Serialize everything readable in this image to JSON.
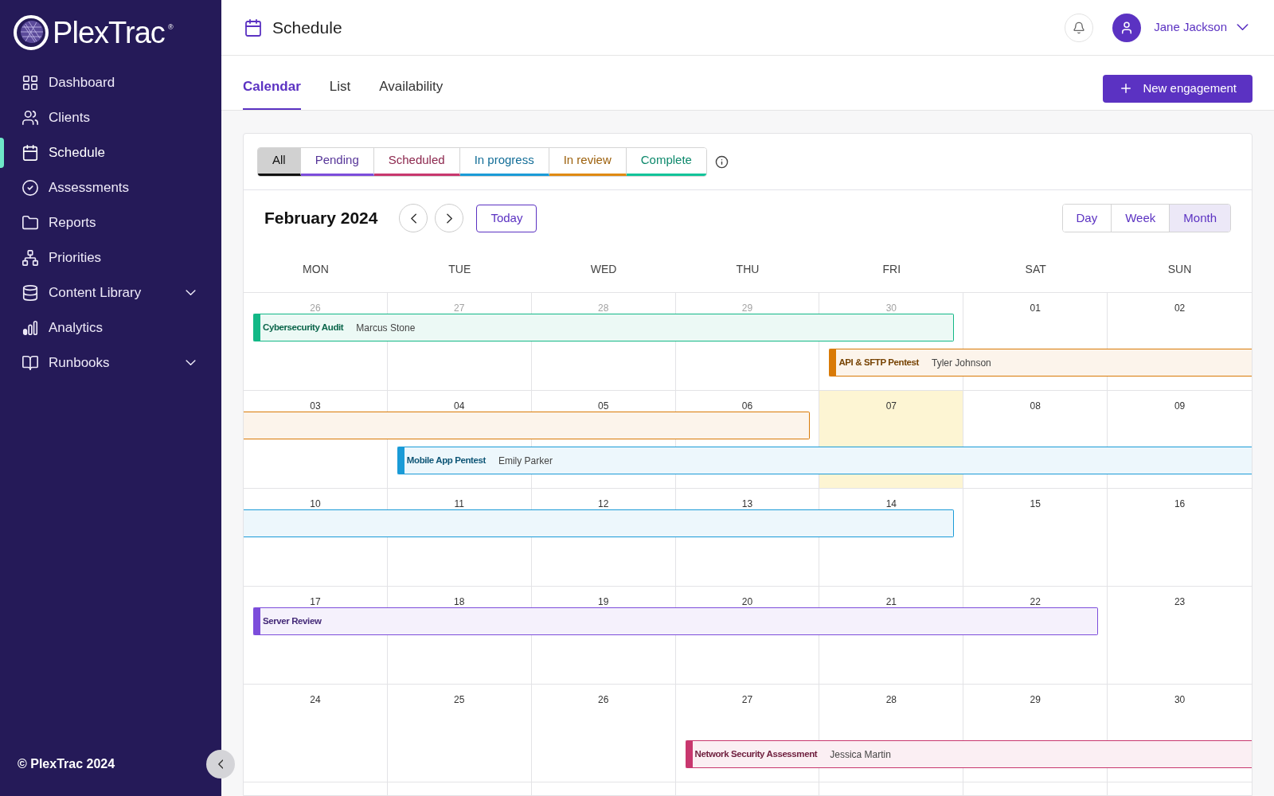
{
  "brand": {
    "name": "PlexTrac",
    "mark": "®"
  },
  "sidebar": {
    "items": [
      {
        "label": "Dashboard",
        "selected": false,
        "has_submenu": false
      },
      {
        "label": "Clients",
        "selected": false,
        "has_submenu": false
      },
      {
        "label": "Schedule",
        "selected": true,
        "has_submenu": false
      },
      {
        "label": "Assessments",
        "selected": false,
        "has_submenu": false
      },
      {
        "label": "Reports",
        "selected": false,
        "has_submenu": false
      },
      {
        "label": "Priorities",
        "selected": false,
        "has_submenu": false
      },
      {
        "label": "Content Library",
        "selected": false,
        "has_submenu": true
      },
      {
        "label": "Analytics",
        "selected": false,
        "has_submenu": false
      },
      {
        "label": "Runbooks",
        "selected": false,
        "has_submenu": true
      }
    ],
    "footer": "© PlexTrac 2024"
  },
  "header": {
    "title": "Schedule",
    "user": "Jane Jackson"
  },
  "tabs": [
    {
      "label": "Calendar",
      "selected": true
    },
    {
      "label": "List",
      "selected": false
    },
    {
      "label": "Availability",
      "selected": false
    }
  ],
  "new_button": "New engagement",
  "filters": [
    {
      "label": "All",
      "selected": true,
      "color": "#111111"
    },
    {
      "label": "Pending",
      "selected": false,
      "color": "#7c4ddb"
    },
    {
      "label": "Scheduled",
      "selected": false,
      "color": "#c8376e"
    },
    {
      "label": "In progress",
      "selected": false,
      "color": "#1a9bd7"
    },
    {
      "label": "In review",
      "selected": false,
      "color": "#e08a12"
    },
    {
      "label": "Complete",
      "selected": false,
      "color": "#12c49a"
    }
  ],
  "calendar": {
    "month": "February 2024",
    "today_button": "Today",
    "views": [
      {
        "label": "Day",
        "selected": false
      },
      {
        "label": "Week",
        "selected": false
      },
      {
        "label": "Month",
        "selected": true
      }
    ],
    "weekdays": [
      "MON",
      "TUE",
      "WED",
      "THU",
      "FRI",
      "SAT",
      "SUN"
    ],
    "weeks": [
      {
        "days": [
          {
            "label": "26",
            "muted": true,
            "today": false,
            "bars": [
              {
                "kind": "upper",
                "color": "#12b886",
                "starts": true,
                "ends": false,
                "title": "Cybersecurity Audit",
                "person": "Marcus Stone"
              }
            ]
          },
          {
            "label": "27",
            "muted": true,
            "today": false,
            "bars": [
              {
                "kind": "upper",
                "color": "#12b886",
                "starts": false,
                "ends": false
              }
            ]
          },
          {
            "label": "28",
            "muted": true,
            "today": false,
            "bars": [
              {
                "kind": "upper",
                "color": "#12b886",
                "starts": false,
                "ends": false
              }
            ]
          },
          {
            "label": "29",
            "muted": true,
            "today": false,
            "bars": [
              {
                "kind": "upper",
                "color": "#12b886",
                "starts": false,
                "ends": false
              }
            ]
          },
          {
            "label": "30",
            "muted": true,
            "today": false,
            "bars": [
              {
                "kind": "upper",
                "color": "#12b886",
                "starts": false,
                "ends": true
              },
              {
                "kind": "lower",
                "color": "#d97a06",
                "starts": true,
                "ends": false,
                "title": "API & SFTP Pentest",
                "person": "Tyler Johnson"
              }
            ]
          },
          {
            "label": "01",
            "muted": false,
            "today": false,
            "bars": [
              {
                "kind": "lower",
                "color": "#d97a06",
                "starts": false,
                "ends": false
              }
            ]
          },
          {
            "label": "02",
            "muted": false,
            "today": false,
            "bars": [
              {
                "kind": "lower",
                "color": "#d97a06",
                "starts": false,
                "ends": false
              }
            ]
          }
        ]
      },
      {
        "days": [
          {
            "label": "03",
            "muted": false,
            "today": false,
            "bars": [
              {
                "kind": "upper",
                "color": "#d97a06",
                "starts": false,
                "ends": false
              }
            ]
          },
          {
            "label": "04",
            "muted": false,
            "today": false,
            "bars": [
              {
                "kind": "upper",
                "color": "#d97a06",
                "starts": false,
                "ends": false
              },
              {
                "kind": "lower",
                "color": "#1a9bd7",
                "starts": true,
                "ends": false,
                "title": "Mobile App Pentest",
                "person": "Emily Parker"
              }
            ]
          },
          {
            "label": "05",
            "muted": false,
            "today": false,
            "bars": [
              {
                "kind": "upper",
                "color": "#d97a06",
                "starts": false,
                "ends": false
              },
              {
                "kind": "lower",
                "color": "#1a9bd7",
                "starts": false,
                "ends": false
              }
            ]
          },
          {
            "label": "06",
            "muted": false,
            "today": false,
            "bars": [
              {
                "kind": "upper",
                "color": "#d97a06",
                "starts": false,
                "ends": true
              },
              {
                "kind": "lower",
                "color": "#1a9bd7",
                "starts": false,
                "ends": false
              }
            ]
          },
          {
            "label": "07",
            "muted": false,
            "today": true,
            "bars": [
              {
                "kind": "lower",
                "color": "#1a9bd7",
                "starts": false,
                "ends": false
              }
            ]
          },
          {
            "label": "08",
            "muted": false,
            "today": false,
            "bars": [
              {
                "kind": "lower",
                "color": "#1a9bd7",
                "starts": false,
                "ends": false
              }
            ]
          },
          {
            "label": "09",
            "muted": false,
            "today": false,
            "bars": [
              {
                "kind": "lower",
                "color": "#1a9bd7",
                "starts": false,
                "ends": false
              }
            ]
          }
        ]
      },
      {
        "days": [
          {
            "label": "10",
            "muted": false,
            "today": false,
            "bars": [
              {
                "kind": "upper",
                "color": "#1a9bd7",
                "starts": false,
                "ends": false
              }
            ]
          },
          {
            "label": "11",
            "muted": false,
            "today": false,
            "bars": [
              {
                "kind": "upper",
                "color": "#1a9bd7",
                "starts": false,
                "ends": false
              }
            ]
          },
          {
            "label": "12",
            "muted": false,
            "today": false,
            "bars": [
              {
                "kind": "upper",
                "color": "#1a9bd7",
                "starts": false,
                "ends": false
              }
            ]
          },
          {
            "label": "13",
            "muted": false,
            "today": false,
            "bars": [
              {
                "kind": "upper",
                "color": "#1a9bd7",
                "starts": false,
                "ends": false
              }
            ]
          },
          {
            "label": "14",
            "muted": false,
            "today": false,
            "bars": [
              {
                "kind": "upper",
                "color": "#1a9bd7",
                "starts": false,
                "ends": true
              }
            ]
          },
          {
            "label": "15",
            "muted": false,
            "today": false
          },
          {
            "label": "16",
            "muted": false,
            "today": false
          }
        ]
      },
      {
        "days": [
          {
            "label": "17",
            "muted": false,
            "today": false,
            "bars": [
              {
                "kind": "upper",
                "color": "#7c4ddb",
                "starts": true,
                "ends": false,
                "title": "Server Review"
              }
            ]
          },
          {
            "label": "18",
            "muted": false,
            "today": false,
            "bars": [
              {
                "kind": "upper",
                "color": "#7c4ddb",
                "starts": false,
                "ends": false
              }
            ]
          },
          {
            "label": "19",
            "muted": false,
            "today": false,
            "bars": [
              {
                "kind": "upper",
                "color": "#7c4ddb",
                "starts": false,
                "ends": false
              }
            ]
          },
          {
            "label": "20",
            "muted": false,
            "today": false,
            "bars": [
              {
                "kind": "upper",
                "color": "#7c4ddb",
                "starts": false,
                "ends": false
              }
            ]
          },
          {
            "label": "21",
            "muted": false,
            "today": false,
            "bars": [
              {
                "kind": "upper",
                "color": "#7c4ddb",
                "starts": false,
                "ends": false
              }
            ]
          },
          {
            "label": "22",
            "muted": false,
            "today": false,
            "bars": [
              {
                "kind": "upper",
                "color": "#7c4ddb",
                "starts": false,
                "ends": true
              }
            ]
          },
          {
            "label": "23",
            "muted": false,
            "today": false
          }
        ]
      },
      {
        "days": [
          {
            "label": "24",
            "muted": false,
            "today": false
          },
          {
            "label": "25",
            "muted": false,
            "today": false
          },
          {
            "label": "26",
            "muted": false,
            "today": false
          },
          {
            "label": "27",
            "muted": false,
            "today": false,
            "bars": [
              {
                "kind": "lower",
                "color": "#c8376e",
                "starts": true,
                "ends": false,
                "title": "Network Security Assessment",
                "person": "Jessica Martin"
              }
            ]
          },
          {
            "label": "28",
            "muted": false,
            "today": false,
            "bars": [
              {
                "kind": "lower",
                "color": "#c8376e",
                "starts": false,
                "ends": false
              }
            ]
          },
          {
            "label": "29",
            "muted": false,
            "today": false,
            "bars": [
              {
                "kind": "lower",
                "color": "#c8376e",
                "starts": false,
                "ends": false
              }
            ]
          },
          {
            "label": "30",
            "muted": false,
            "today": false,
            "bars": [
              {
                "kind": "lower",
                "color": "#c8376e",
                "starts": false,
                "ends": false
              }
            ]
          }
        ]
      }
    ]
  }
}
